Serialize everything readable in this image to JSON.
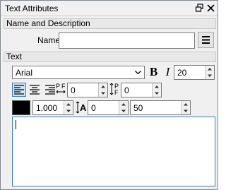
{
  "window": {
    "title": "Text Attributes"
  },
  "sections": {
    "name_and_description": "Name and Description",
    "text": "Text"
  },
  "name_field": {
    "label": "Name",
    "value": ""
  },
  "font": {
    "family": "Arial",
    "bold_label": "B",
    "italic_label": "I",
    "size": "20"
  },
  "paragraph": {
    "indent_label": "P F",
    "indent_value": "0",
    "spacing_label": "P F",
    "spacing_value": "0"
  },
  "style": {
    "color": "#000000",
    "opacity": "1.000",
    "spacing_value": "0",
    "line_height_value": "50"
  },
  "text_content": {
    "value": ""
  },
  "icons": [
    "restore-icon",
    "close-icon",
    "menu-icon",
    "chevron-down-icon",
    "align-left-icon",
    "align-center-icon",
    "align-right-icon",
    "paragraph-indent-icon",
    "paragraph-spacing-icon",
    "letter-spacing-icon"
  ]
}
